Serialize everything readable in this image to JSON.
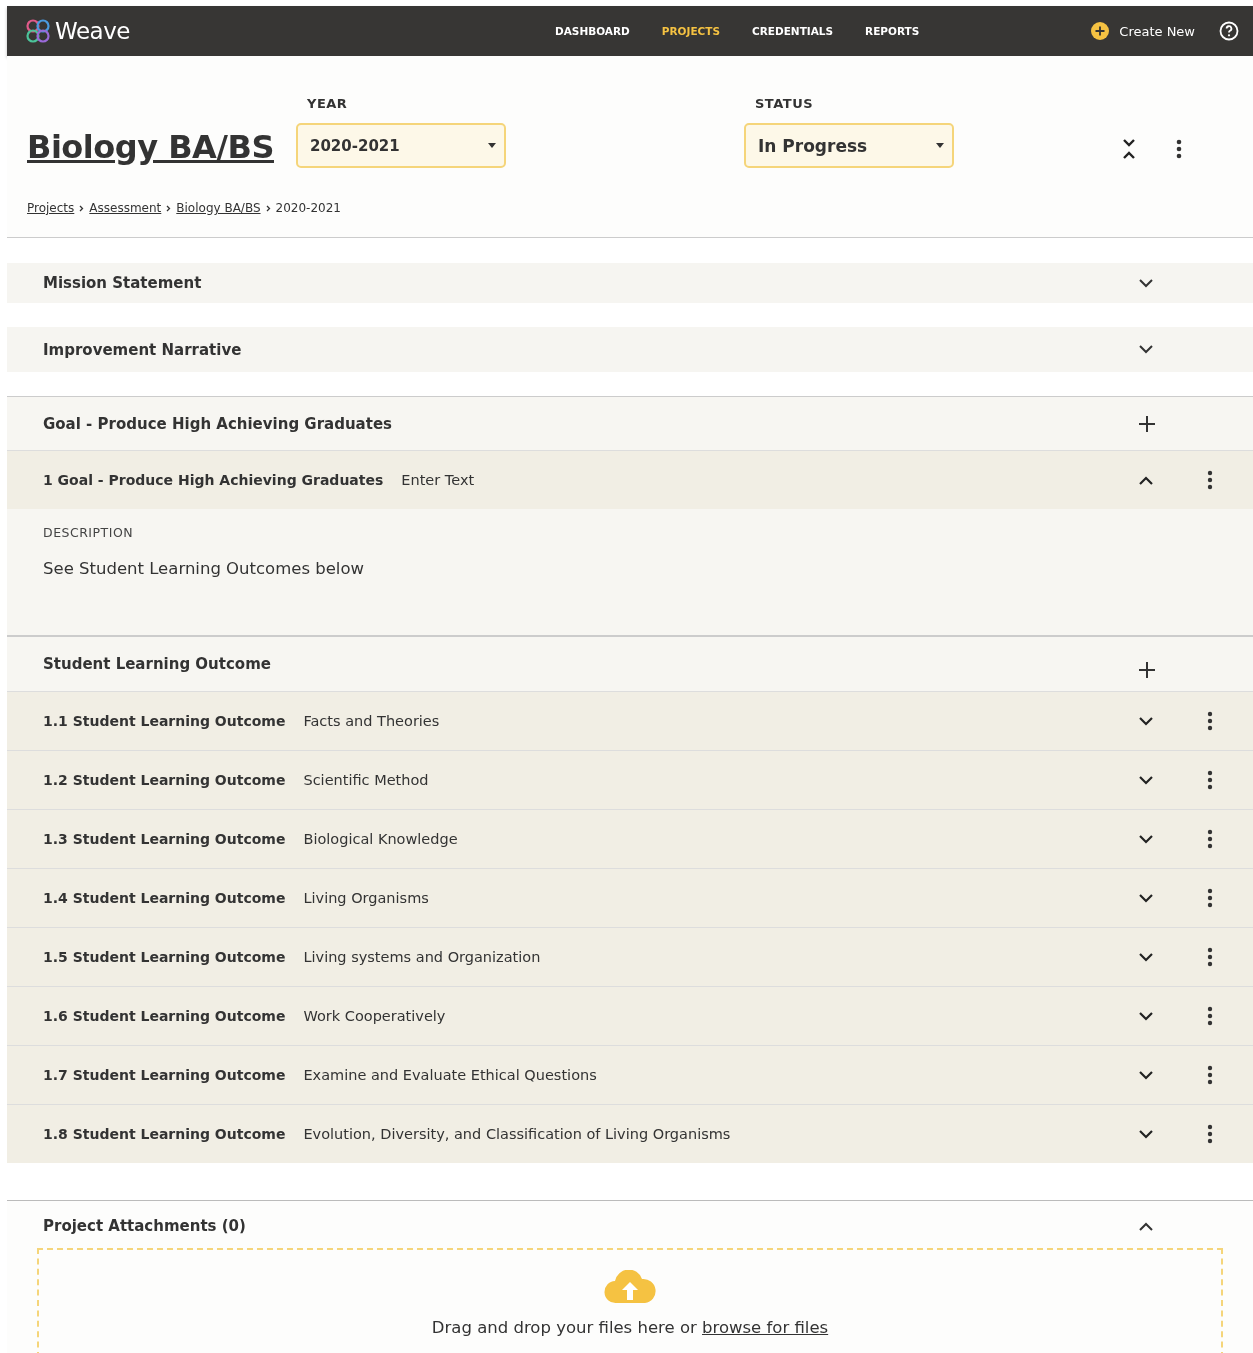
{
  "nav": {
    "brand": "Weave",
    "links": [
      {
        "label": "DASHBOARD",
        "selected": false
      },
      {
        "label": "PROJECTS",
        "selected": true
      },
      {
        "label": "CREDENTIALS",
        "selected": false
      },
      {
        "label": "REPORTS",
        "selected": false
      }
    ],
    "create": "Create New"
  },
  "header": {
    "title": "Biology BA/BS",
    "year": {
      "label": "YEAR",
      "value": "2020-2021"
    },
    "status": {
      "label": "STATUS",
      "value": "In Progress"
    },
    "breadcrumbs": [
      {
        "label": "Projects",
        "link": true
      },
      {
        "label": "Assessment",
        "link": true
      },
      {
        "label": "Biology BA/BS",
        "link": true
      },
      {
        "label": "2020-2021",
        "link": false
      }
    ]
  },
  "sections": [
    {
      "title": "Mission Statement",
      "expanded": false
    },
    {
      "title": "Improvement Narrative",
      "expanded": false
    }
  ],
  "goal": {
    "title": "Goal - Produce High Achieving Graduates",
    "items": [
      {
        "number": "1",
        "title": "Goal - Produce High Achieving Graduates",
        "text": "Enter Text",
        "expanded": true,
        "description_label": "DESCRIPTION",
        "description": "See Student Learning Outcomes below"
      }
    ]
  },
  "outcomes": {
    "title": "Student Learning Outcome",
    "items": [
      {
        "number": "1.1",
        "title": "Student Learning Outcome",
        "text": "Facts and Theories",
        "expanded": false
      },
      {
        "number": "1.2",
        "title": "Student Learning Outcome",
        "text": "Scientific Method",
        "expanded": false
      },
      {
        "number": "1.3",
        "title": "Student Learning Outcome",
        "text": "Biological Knowledge",
        "expanded": false
      },
      {
        "number": "1.4",
        "title": "Student Learning Outcome",
        "text": "Living Organisms",
        "expanded": false
      },
      {
        "number": "1.5",
        "title": "Student Learning Outcome",
        "text": "Living systems and Organization",
        "expanded": false
      },
      {
        "number": "1.6",
        "title": "Student Learning Outcome",
        "text": "Work Cooperatively",
        "expanded": false
      },
      {
        "number": "1.7",
        "title": "Student Learning Outcome",
        "text": "Examine and Evaluate Ethical Questions",
        "expanded": false
      },
      {
        "number": "1.8",
        "title": "Student Learning Outcome",
        "text": "Evolution, Diversity, and Classification of Living Organisms",
        "expanded": false
      }
    ]
  },
  "attachments": {
    "title": "Project Attachments (0)",
    "expanded": true,
    "drop_text": "Drag and drop your files here or",
    "browse_link": "browse for files"
  }
}
